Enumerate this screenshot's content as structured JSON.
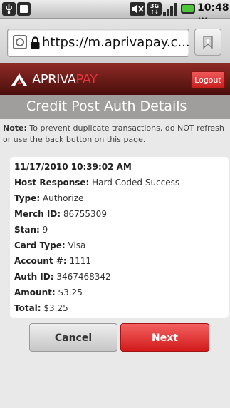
{
  "status_bar": {
    "time": "10:48",
    "ampm": "AM",
    "icons": [
      "usb-icon",
      "sd-card-icon",
      "mute-icon",
      "3g-icon",
      "signal-icon",
      "battery-icon"
    ],
    "network_type": "3G"
  },
  "browser": {
    "url": "https://m.aprivapay.c...",
    "icons": [
      "globe-icon",
      "lock-icon",
      "bookmark-icon"
    ]
  },
  "header": {
    "brand_part1": "APRIVA",
    "brand_part2": "PAY",
    "logout_label": "Logout",
    "colors": {
      "header_bg": "#6b1a17",
      "brand_accent": "#e8343c",
      "logout_bg": "#e03434"
    }
  },
  "page": {
    "title": "Credit Post Auth Details",
    "note_label": "Note:",
    "note_text": " To prevent duplicate transactions, do NOT refresh or use the back button on this page."
  },
  "details": {
    "timestamp": "11/17/2010 10:39:02 AM",
    "fields": [
      {
        "label": "Host Response:",
        "value": " Hard Coded Success"
      },
      {
        "label": "Type:",
        "value": " Authorize"
      },
      {
        "label": "Merch ID:",
        "value": " 86755309"
      },
      {
        "label": "Stan:",
        "value": " 9"
      },
      {
        "label": "Card Type:",
        "value": " Visa"
      },
      {
        "label": "Account #:",
        "value": " 1111"
      },
      {
        "label": "Auth ID:",
        "value": " 3467468342"
      },
      {
        "label": "Amount:",
        "value": " $3.25"
      },
      {
        "label": "Total:",
        "value": " $3.25"
      }
    ]
  },
  "actions": {
    "cancel_label": "Cancel",
    "next_label": "Next",
    "colors": {
      "next_bg": "#e02626"
    }
  }
}
